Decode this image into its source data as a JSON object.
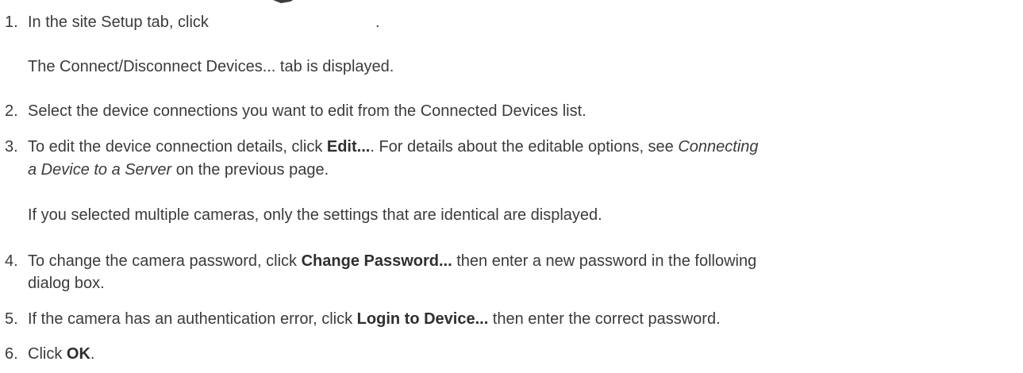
{
  "steps": [
    {
      "number": "1.",
      "text_before_icon": "In the site Setup tab, click",
      "text_after_icon": ".",
      "icon": "connect-disconnect-devices-icon",
      "note": "The Connect/Disconnect Devices... tab is displayed."
    },
    {
      "number": "2.",
      "text": "Select the device connections you want to edit from the Connected Devices list."
    },
    {
      "number": "3.",
      "t1": "To edit the device connection details, click ",
      "b1": "Edit...",
      "t2": ". For details about the editable options, see ",
      "i1": "Connecting",
      "line2_i": "a Device to a Server",
      "line2_t": " on the previous page.",
      "note": "If you selected multiple cameras, only the settings that are identical are displayed."
    },
    {
      "number": "4.",
      "t1": "To change the camera password, click ",
      "b1": "Change Password...",
      "t2": " then enter a new password in the following",
      "line2": "dialog box."
    },
    {
      "number": "5.",
      "t1": "If the camera has an authentication error, click ",
      "b1": "Login to Device...",
      "t2": " then enter the correct password."
    },
    {
      "number": "6.",
      "t1": "Click ",
      "b1": "OK",
      "t2": "."
    }
  ]
}
